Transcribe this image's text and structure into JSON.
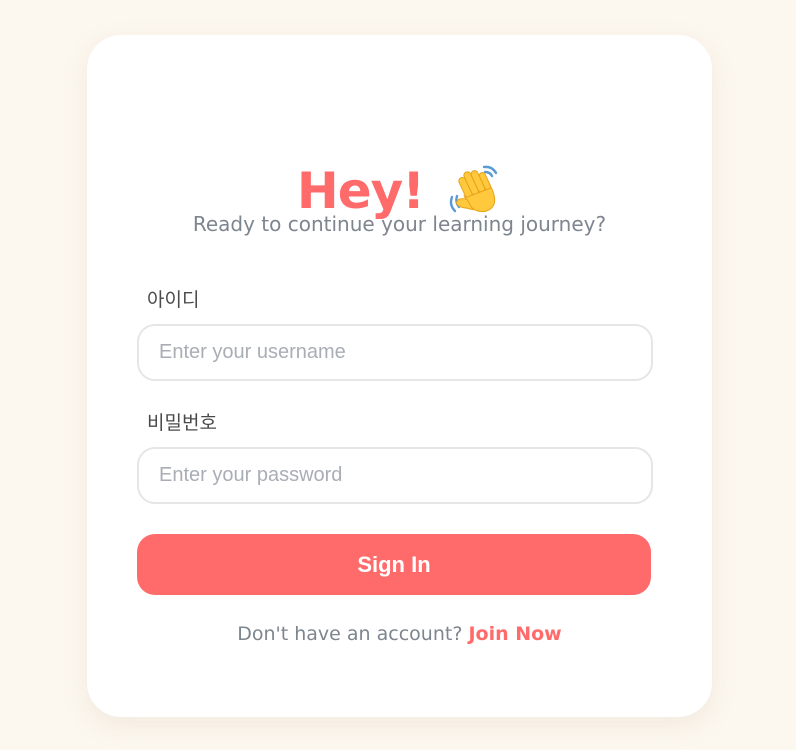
{
  "header": {
    "title": "Hey!",
    "title_icon": "waving-hand-icon",
    "subtitle": "Ready to continue your learning journey?"
  },
  "form": {
    "username": {
      "label": "아이디",
      "placeholder": "Enter your username",
      "value": ""
    },
    "password": {
      "label": "비밀번호",
      "placeholder": "Enter your password",
      "value": ""
    },
    "submit_label": "Sign In"
  },
  "footer": {
    "prompt": "Don't have an account?",
    "link_label": "Join Now"
  },
  "colors": {
    "accent": "#ff6b6b",
    "background": "#fcf7ef",
    "card": "#ffffff",
    "muted_text": "#7d858f"
  }
}
